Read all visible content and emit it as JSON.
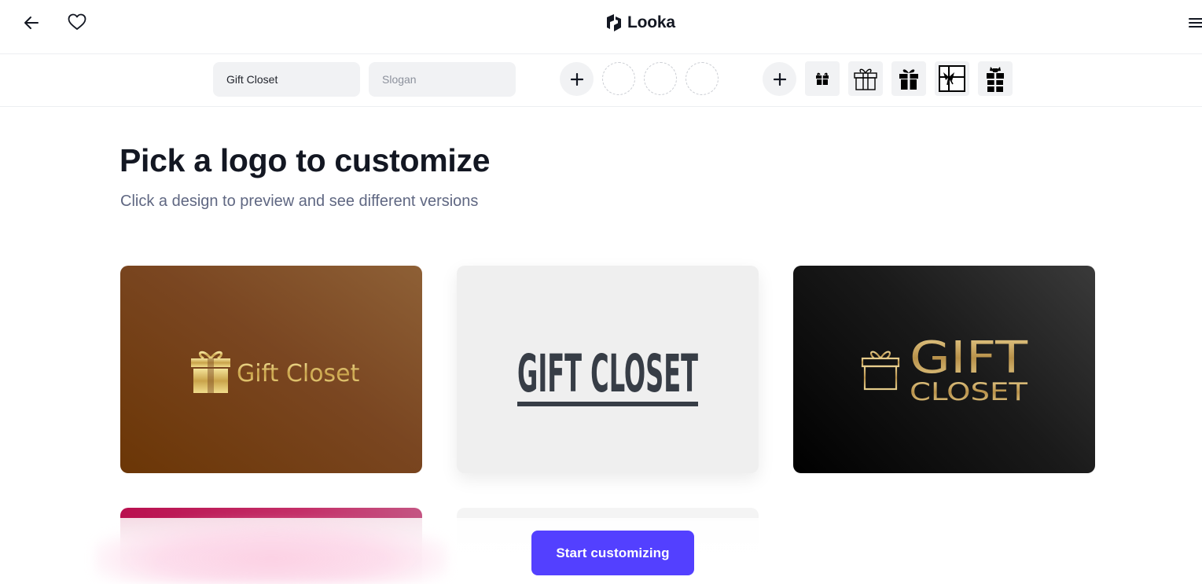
{
  "header": {
    "brand_name": "Looka",
    "icons": {
      "back": "arrow-left-icon",
      "favorite": "heart-icon",
      "menu": "hamburger-icon",
      "brand": "looka-logo-icon"
    }
  },
  "toolbar": {
    "company_name_value": "Gift Closet",
    "slogan_placeholder": "Slogan",
    "add_color_label": "+",
    "add_symbol_label": "+",
    "symbols": [
      "gift-small-icon",
      "gift-outline-icon",
      "gift-bow-icon",
      "gift-box-ribbon-icon",
      "gift-tall-icon"
    ]
  },
  "main": {
    "title": "Pick a logo to customize",
    "subtitle": "Click a design to preview and see different versions"
  },
  "logos": [
    {
      "text": "Gift Closet",
      "colors": {
        "background": "#7a4621",
        "text": "#d8c37a"
      }
    },
    {
      "text": "GIFT CLOSET",
      "colors": {
        "background": "#efefef",
        "text": "#373d46"
      }
    },
    {
      "line1": "GIFT",
      "line2": "CLOSET",
      "colors": {
        "background": "#111111",
        "text": "#c9a860"
      }
    }
  ],
  "cta": {
    "label": "Start customizing",
    "color": "#5340ff"
  }
}
